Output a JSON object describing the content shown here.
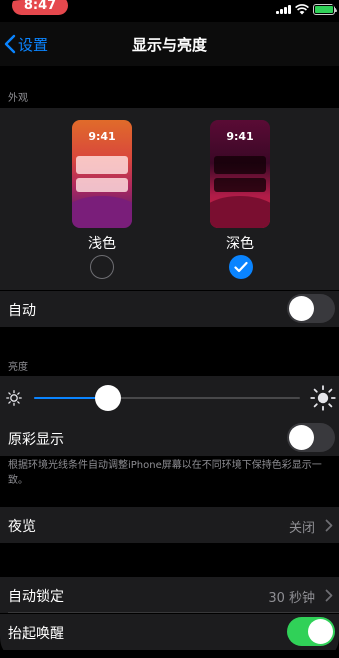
{
  "status_bar": {
    "time": "8:47"
  },
  "nav": {
    "back_label": "设置",
    "title": "显示与亮度"
  },
  "appearance": {
    "header": "外观",
    "options": [
      {
        "label": "浅色",
        "preview_time": "9:41",
        "selected": false
      },
      {
        "label": "深色",
        "preview_time": "9:41",
        "selected": true
      }
    ],
    "auto_label": "自动",
    "auto_enabled": false
  },
  "brightness": {
    "header": "亮度",
    "level": 0.28,
    "true_tone_label": "原彩显示",
    "true_tone_enabled": false,
    "footnote": "根据环境光线条件自动调整iPhone屏幕以在不同环境下保持色彩显示一致。"
  },
  "night_shift": {
    "label": "夜览",
    "value": "关闭"
  },
  "auto_lock": {
    "label": "自动锁定",
    "value": "30 秒钟"
  },
  "raise_to_wake": {
    "label": "抬起唤醒",
    "enabled": true
  },
  "colors": {
    "accent": "#0a84ff",
    "toggle_on": "#30d158",
    "status_time_bg": "#e5484d"
  }
}
